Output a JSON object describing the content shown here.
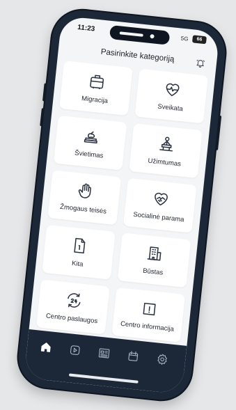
{
  "status": {
    "time": "11:23",
    "network": "5G",
    "battery": "66"
  },
  "header": {
    "title": "Pasirinkite kategoriją",
    "bell_icon": "bell-icon"
  },
  "categories": [
    {
      "label": "Migracija",
      "icon": "suitcase-icon"
    },
    {
      "label": "Sveikata",
      "icon": "heart-pulse-icon"
    },
    {
      "label": "Švietimas",
      "icon": "apple-books-icon"
    },
    {
      "label": "Užimtumas",
      "icon": "person-podium-icon"
    },
    {
      "label": "Žmogaus teisės",
      "icon": "raised-hand-icon"
    },
    {
      "label": "Socialinė parama",
      "icon": "handshake-heart-icon"
    },
    {
      "label": "Kita",
      "icon": "document-icon"
    },
    {
      "label": "Būstas",
      "icon": "buildings-icon"
    },
    {
      "label": "Centro paslaugos",
      "icon": "clock-24-icon"
    },
    {
      "label": "Centro informacija",
      "icon": "info-document-icon"
    }
  ],
  "tabbar": {
    "tabs": [
      {
        "icon": "home-icon",
        "active": true
      },
      {
        "icon": "play-icon",
        "active": false
      },
      {
        "icon": "news-icon",
        "active": false
      },
      {
        "icon": "calendar-icon",
        "active": false
      },
      {
        "icon": "settings-gear-icon",
        "active": false
      }
    ]
  },
  "colors": {
    "phone_frame": "#1c2838",
    "screen_bg": "#f4f5f7",
    "card_bg": "#ffffff",
    "active_tab": "#ffffff",
    "inactive_tab": "#aab3c0"
  }
}
